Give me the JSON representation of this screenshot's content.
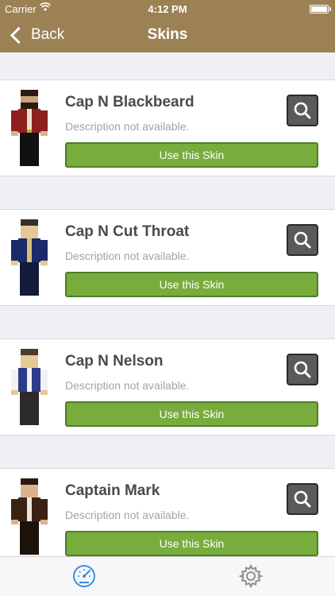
{
  "status_bar": {
    "carrier": "Carrier",
    "time": "4:12 PM"
  },
  "nav": {
    "back_label": "Back",
    "title": "Skins"
  },
  "skins": [
    {
      "name": "Cap N Blackbeard",
      "description": "Description not available.",
      "button": "Use this Skin",
      "coat_color": "#8e1f1f",
      "hat_color": "#2a1a10"
    },
    {
      "name": "Cap N Cut Throat",
      "description": "Description not available.",
      "button": "Use this Skin",
      "coat_color": "#1b2a6b",
      "hat_color": "#3b2f26"
    },
    {
      "name": "Cap N Nelson",
      "description": "Description not available.",
      "button": "Use this Skin",
      "coat_color": "#2b3b8a",
      "hat_color": "#4a3b2b"
    },
    {
      "name": "Captain Mark",
      "description": "Description not available.",
      "button": "Use this Skin",
      "coat_color": "#3a2314",
      "hat_color": "#2a1a10"
    }
  ],
  "tabbar": {
    "items": [
      {
        "icon": "dashboard-icon",
        "active": true
      },
      {
        "icon": "gear-icon",
        "active": false
      }
    ]
  },
  "colors": {
    "nav_bg": "#9c8155",
    "button_green": "#78ac3d",
    "tab_active": "#3b8ee6"
  }
}
